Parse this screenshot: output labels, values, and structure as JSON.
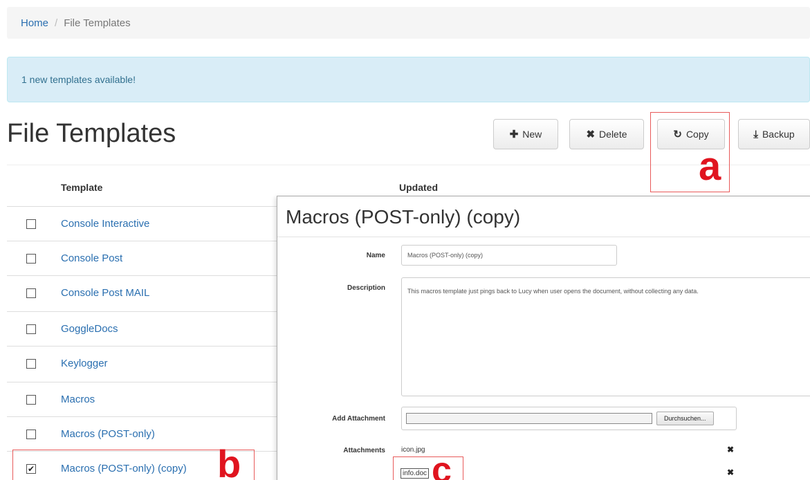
{
  "breadcrumb": {
    "home": "Home",
    "separator": "/",
    "current": "File Templates"
  },
  "alert": {
    "text": "1 new templates available!"
  },
  "page": {
    "title": "File Templates"
  },
  "toolbar": {
    "new_icon": "✚",
    "new_label": "New",
    "delete_icon": "✖",
    "delete_label": "Delete",
    "copy_icon": "↻",
    "copy_label": "Copy",
    "backup_icon": "⤓",
    "backup_label": "Backup"
  },
  "annotations": {
    "a": "a",
    "b": "b",
    "c": "c",
    "color": "#e0141f"
  },
  "table": {
    "headers": {
      "template": "Template",
      "updated": "Updated"
    },
    "rows": [
      {
        "name": "Console Interactive",
        "checked": false
      },
      {
        "name": "Console Post",
        "checked": false
      },
      {
        "name": "Console Post MAIL",
        "checked": false
      },
      {
        "name": "GoggleDocs",
        "checked": false
      },
      {
        "name": "Keylogger",
        "checked": false
      },
      {
        "name": "Macros",
        "checked": false
      },
      {
        "name": "Macros (POST-only)",
        "checked": false
      },
      {
        "name": "Macros (POST-only) (copy)",
        "checked": true
      }
    ]
  },
  "modal": {
    "title": "Macros (POST-only) (copy)",
    "name_label": "Name",
    "name_value": "Macros (POST-only) (copy)",
    "description_label": "Description",
    "description_value": "This macros template just pings back to Lucy when user opens the document, without collecting any data.",
    "add_attachment_label": "Add Attachment",
    "browse_button": "Durchsuchen...",
    "attachments_label": "Attachments",
    "attachments": [
      "icon.jpg",
      "info.doc"
    ]
  },
  "colors": {
    "link": "#2a6fb0",
    "alert_bg": "#d9edf7",
    "alert_text": "#31708f",
    "annotation_red": "#e0141f"
  }
}
